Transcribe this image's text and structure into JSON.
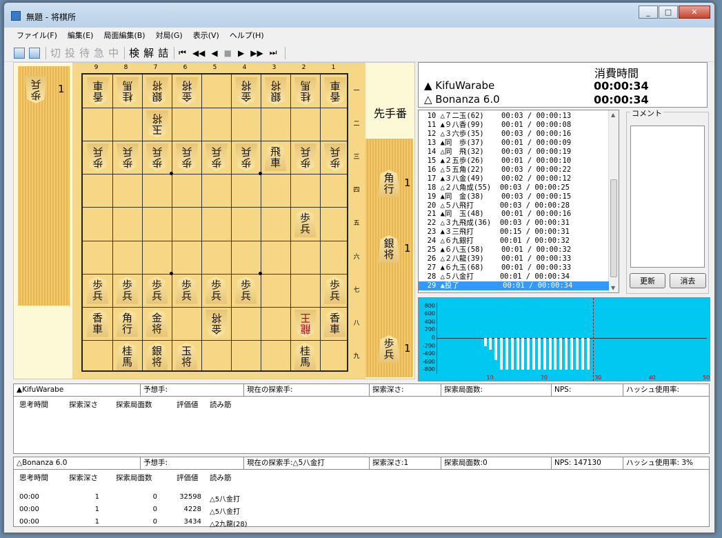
{
  "window": {
    "title": "無題 - 将棋所",
    "minimize": "0",
    "maximize": "1",
    "close": "r"
  },
  "menu": [
    "ファイル(F)",
    "編集(E)",
    "局面編集(B)",
    "対局(G)",
    "表示(V)",
    "ヘルプ(H)"
  ],
  "toolbar": {
    "icons": [
      "save-icon",
      "open-icon"
    ],
    "buttons": [
      {
        "label": "切",
        "enabled": false
      },
      {
        "label": "投",
        "enabled": false
      },
      {
        "label": "待",
        "enabled": false
      },
      {
        "label": "急",
        "enabled": false
      },
      {
        "label": "中",
        "enabled": false
      },
      {
        "label": "検",
        "enabled": true
      },
      {
        "label": "解",
        "enabled": true
      },
      {
        "label": "詰",
        "enabled": true
      }
    ],
    "nav": [
      {
        "label": "⏮",
        "enabled": true
      },
      {
        "label": "◀◀",
        "enabled": true
      },
      {
        "label": "◀",
        "enabled": true
      },
      {
        "label": "■",
        "enabled": false
      },
      {
        "label": "▶",
        "enabled": true
      },
      {
        "label": "▶▶",
        "enabled": true
      },
      {
        "label": "⏭",
        "enabled": true
      }
    ]
  },
  "board": {
    "columns": [
      "9",
      "8",
      "7",
      "6",
      "5",
      "4",
      "3",
      "2",
      "1"
    ],
    "rows": [
      "一",
      "二",
      "三",
      "四",
      "五",
      "六",
      "七",
      "八",
      "九"
    ],
    "pieces": [
      {
        "col": 9,
        "row": 1,
        "text": "香車",
        "side": "gote"
      },
      {
        "col": 8,
        "row": 1,
        "text": "桂馬",
        "side": "gote"
      },
      {
        "col": 7,
        "row": 1,
        "text": "銀将",
        "side": "gote"
      },
      {
        "col": 6,
        "row": 1,
        "text": "金将",
        "side": "gote"
      },
      {
        "col": 4,
        "row": 1,
        "text": "金将",
        "side": "gote"
      },
      {
        "col": 3,
        "row": 1,
        "text": "銀将",
        "side": "gote"
      },
      {
        "col": 2,
        "row": 1,
        "text": "桂馬",
        "side": "gote"
      },
      {
        "col": 1,
        "row": 1,
        "text": "香車",
        "side": "gote"
      },
      {
        "col": 7,
        "row": 2,
        "text": "玉将",
        "side": "gote"
      },
      {
        "col": 9,
        "row": 3,
        "text": "歩兵",
        "side": "gote"
      },
      {
        "col": 8,
        "row": 3,
        "text": "歩兵",
        "side": "gote"
      },
      {
        "col": 7,
        "row": 3,
        "text": "歩兵",
        "side": "gote"
      },
      {
        "col": 6,
        "row": 3,
        "text": "歩兵",
        "side": "gote"
      },
      {
        "col": 5,
        "row": 3,
        "text": "歩兵",
        "side": "gote"
      },
      {
        "col": 4,
        "row": 3,
        "text": "歩兵",
        "side": "gote"
      },
      {
        "col": 3,
        "row": 3,
        "text": "飛車",
        "side": "sente"
      },
      {
        "col": 2,
        "row": 3,
        "text": "歩兵",
        "side": "gote"
      },
      {
        "col": 1,
        "row": 3,
        "text": "歩兵",
        "side": "gote"
      },
      {
        "col": 2,
        "row": 5,
        "text": "歩兵",
        "side": "sente"
      },
      {
        "col": 9,
        "row": 7,
        "text": "歩兵",
        "side": "sente"
      },
      {
        "col": 8,
        "row": 7,
        "text": "歩兵",
        "side": "sente"
      },
      {
        "col": 7,
        "row": 7,
        "text": "歩兵",
        "side": "sente"
      },
      {
        "col": 6,
        "row": 7,
        "text": "歩兵",
        "side": "sente"
      },
      {
        "col": 5,
        "row": 7,
        "text": "歩兵",
        "side": "sente"
      },
      {
        "col": 4,
        "row": 7,
        "text": "歩兵",
        "side": "sente"
      },
      {
        "col": 1,
        "row": 7,
        "text": "歩兵",
        "side": "sente"
      },
      {
        "col": 9,
        "row": 8,
        "text": "香車",
        "side": "sente"
      },
      {
        "col": 8,
        "row": 8,
        "text": "角行",
        "side": "sente"
      },
      {
        "col": 7,
        "row": 8,
        "text": "金将",
        "side": "sente"
      },
      {
        "col": 5,
        "row": 8,
        "text": "金将",
        "side": "gote"
      },
      {
        "col": 2,
        "row": 8,
        "text": "龍王",
        "side": "gote",
        "promoted": true
      },
      {
        "col": 1,
        "row": 8,
        "text": "香車",
        "side": "sente"
      },
      {
        "col": 8,
        "row": 9,
        "text": "桂馬",
        "side": "sente"
      },
      {
        "col": 7,
        "row": 9,
        "text": "銀将",
        "side": "sente"
      },
      {
        "col": 6,
        "row": 9,
        "text": "玉将",
        "side": "sente"
      },
      {
        "col": 2,
        "row": 9,
        "text": "桂馬",
        "side": "sente"
      }
    ]
  },
  "gote_hand": [
    {
      "text": "歩兵",
      "count": "1"
    }
  ],
  "sente_hand": [
    {
      "text": "角行",
      "count": "1"
    },
    {
      "text": "銀将",
      "count": "1"
    },
    {
      "text": "歩兵",
      "count": "1"
    }
  ],
  "turn_label": "先手番",
  "clock": {
    "header": "消費時間",
    "sente_name": "▲ KifuWarabe",
    "gote_name": "△ Bonanza 6.0",
    "sente_time": "00:00:34",
    "gote_time": "00:00:34"
  },
  "kifu": [
    "  10 △７二玉(62)    00:03 / 00:00:13",
    "  11 ▲９八香(99)    00:01 / 00:00:08",
    "  12 △３六歩(35)    00:03 / 00:00:16",
    "  13 ▲同　歩(37)    00:01 / 00:00:09",
    "  14 △同　飛(32)    00:03 / 00:00:19",
    "  15 ▲２五歩(26)    00:01 / 00:00:10",
    "  16 △５五角(22)    00:03 / 00:00:22",
    "  17 ▲３八金(49)    00:02 / 00:00:12",
    "  18 △２八角成(55)  00:03 / 00:00:25",
    "  19 ▲同　金(38)    00:03 / 00:00:15",
    "  20 △５八飛打      00:03 / 00:00:28",
    "  21 ▲同　玉(48)    00:01 / 00:00:16",
    "  22 △３九飛成(36)  00:03 / 00:00:31",
    "  23 ▲３三飛打      00:15 / 00:00:31",
    "  24 △６九銀打      00:01 / 00:00:32",
    "  25 ▲６八玉(58)    00:01 / 00:00:32",
    "  26 △２八龍(39)    00:01 / 00:00:33",
    "  27 ▲６九玉(68)    00:01 / 00:00:33",
    "  28 △５八金打      00:01 / 00:00:34",
    "  29 ▲投了          00:01 / 00:00:34"
  ],
  "kifu_selected": 19,
  "comment": {
    "legend": "コメント",
    "update": "更新",
    "clear": "消去"
  },
  "eval_graph": {
    "y_ticks": [
      "800",
      "600",
      "400",
      "200",
      "0",
      "-200",
      "-400",
      "-600",
      "-800"
    ],
    "x_labels": [
      "10",
      "20",
      "30",
      "40",
      "50"
    ],
    "bar_values": [
      -200,
      -300,
      -550,
      -800,
      -800,
      -800,
      -800,
      -800,
      -800,
      -800,
      -800,
      -800,
      -800,
      -800,
      -800,
      -800,
      -800,
      -800,
      -800,
      -800
    ],
    "bar_start_move": 9,
    "current_move": 29,
    "ylim": [
      -900,
      900
    ],
    "xlim": [
      0,
      50
    ],
    "bg_color": "#00c8f0"
  },
  "engine1": {
    "name": "▲KifuWarabe",
    "predicted": "予想手:",
    "current": "現在の探索手:",
    "depth": "探索深さ:",
    "nodes": "探索局面数:",
    "nps": "NPS:",
    "hash": "ハッシュ使用率:",
    "columns": [
      "思考時間",
      "探索深さ",
      "探索局面数",
      "評価値",
      "読み筋"
    ],
    "rows": []
  },
  "engine2": {
    "name": "△Bonanza 6.0",
    "predicted": "予想手:",
    "current": "現在の探索手:△5八金打",
    "depth": "探索深さ:1",
    "nodes": "探索局面数:0",
    "nps": "NPS: 147130",
    "hash": "ハッシュ使用率: 3%",
    "columns": [
      "思考時間",
      "探索深さ",
      "探索局面数",
      "評価値",
      "読み筋"
    ],
    "rows": [
      {
        "time": "00:00",
        "depth": "1",
        "nodes": "0",
        "eval": "32598",
        "pv": "△5八金打"
      },
      {
        "time": "00:00",
        "depth": "1",
        "nodes": "0",
        "eval": "4228",
        "pv": "△5八金打"
      },
      {
        "time": "00:00",
        "depth": "1",
        "nodes": "0",
        "eval": "3434",
        "pv": "△2九龍(28)"
      }
    ]
  }
}
